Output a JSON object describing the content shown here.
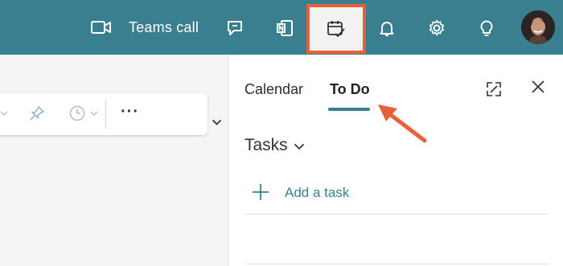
{
  "topbar": {
    "teams_call_label": "Teams call",
    "icons": [
      "video-icon",
      "chat-icon",
      "onenote-icon",
      "todo-icon",
      "bell-icon",
      "settings-icon",
      "lightbulb-icon"
    ],
    "accent_color": "#3a7f8f",
    "highlight_color": "#e8603a"
  },
  "panel": {
    "tabs": [
      {
        "label": "Calendar",
        "active": false
      },
      {
        "label": "To Do",
        "active": true
      }
    ],
    "section_title": "Tasks",
    "add_task_label": "Add a task"
  },
  "left_toolbar": {
    "more_label": "···"
  }
}
